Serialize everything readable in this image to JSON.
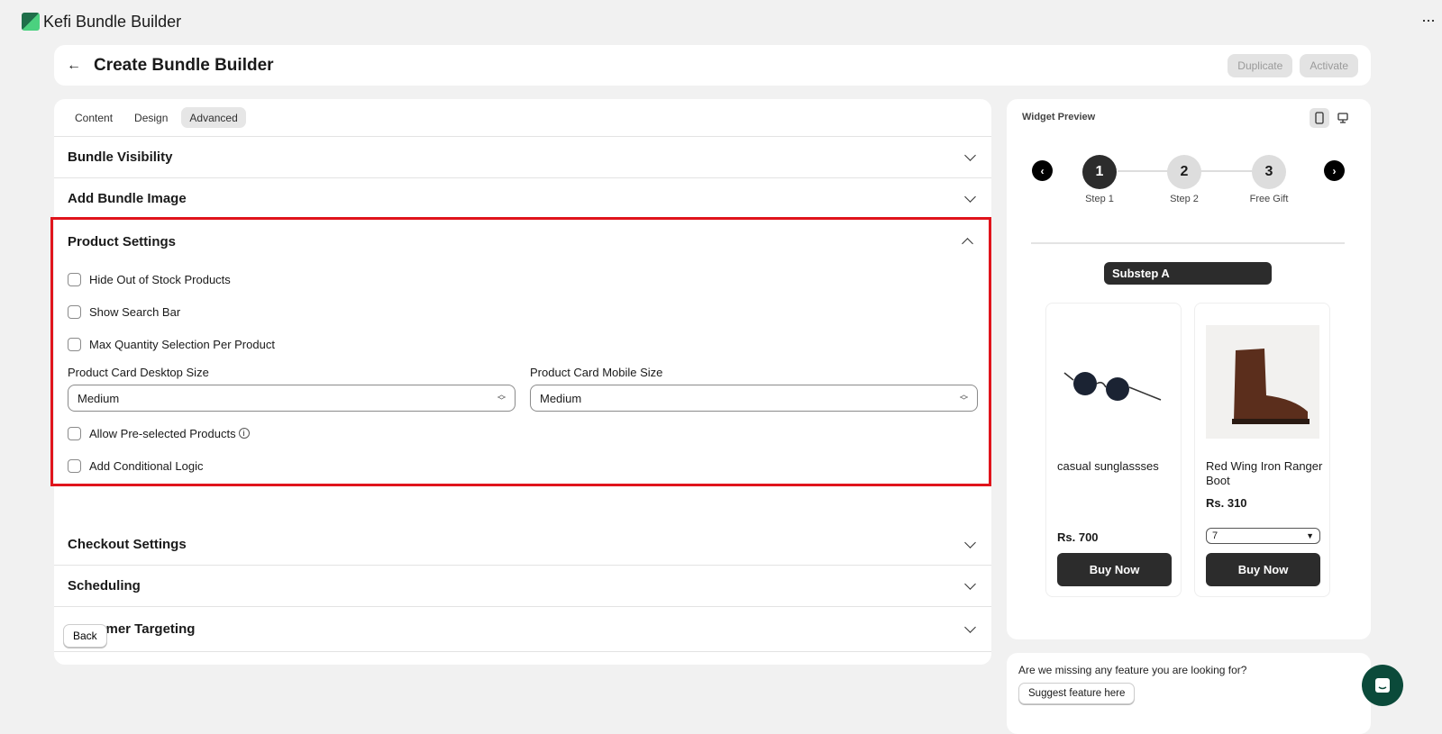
{
  "app": {
    "title": "Kefi Bundle Builder",
    "more": "···"
  },
  "header": {
    "title": "Create Bundle Builder",
    "duplicate": "Duplicate",
    "activate": "Activate"
  },
  "tabs": [
    "Content",
    "Design",
    "Advanced"
  ],
  "sections": {
    "visibility": "Bundle Visibility",
    "image": "Add Bundle Image",
    "product": "Product Settings",
    "checkout": "Checkout Settings",
    "scheduling": "Scheduling",
    "targeting": "Customer Targeting"
  },
  "product_settings": {
    "hide_oos": "Hide Out of Stock Products",
    "search": "Show Search Bar",
    "max_qty": "Max Quantity Selection Per Product",
    "desktop_label": "Product Card Desktop Size",
    "desktop_value": "Medium",
    "mobile_label": "Product Card Mobile Size",
    "mobile_value": "Medium",
    "preselected": "Allow Pre-selected Products",
    "conditional": "Add Conditional Logic",
    "info": "i"
  },
  "back": "Back",
  "preview": {
    "title": "Widget Preview",
    "steps": [
      {
        "num": "1",
        "label": "Step 1"
      },
      {
        "num": "2",
        "label": "Step 2"
      },
      {
        "num": "3",
        "label": "Free Gift"
      }
    ],
    "substep": "Substep A",
    "products": [
      {
        "name": "casual sunglassses",
        "price": "Rs. 700",
        "buy": "Buy Now"
      },
      {
        "name": "Red Wing Iron Ranger Boot",
        "price": "Rs. 310",
        "qty": "7",
        "buy": "Buy Now"
      }
    ]
  },
  "feature": {
    "question": "Are we missing any feature you are looking for?",
    "button": "Suggest feature here"
  }
}
